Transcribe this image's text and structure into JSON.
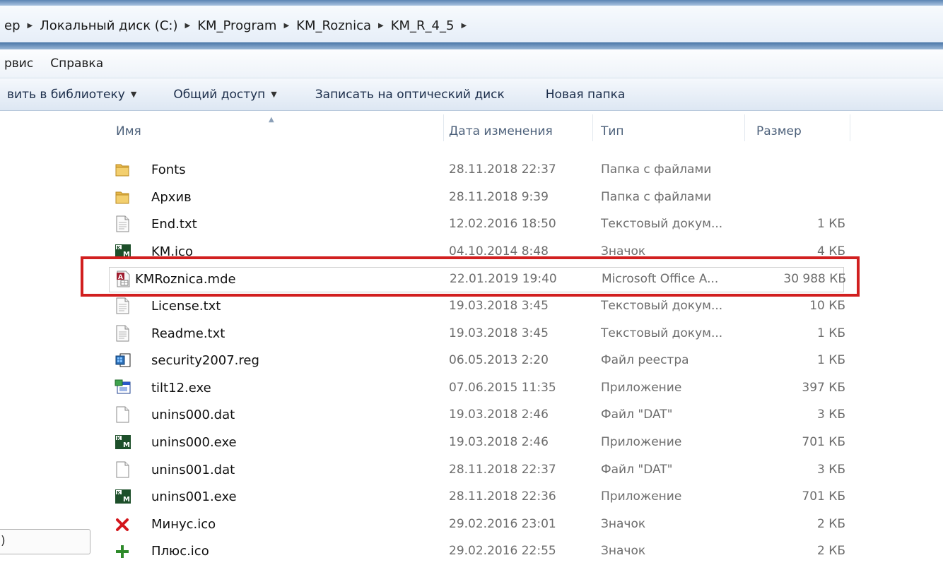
{
  "breadcrumb": {
    "items": [
      "ер",
      "Локальный диск (C:)",
      "KM_Program",
      "KM_Roznica",
      "KM_R_4_5"
    ]
  },
  "menu": {
    "items": [
      "рвис",
      "Справка"
    ]
  },
  "commands": {
    "add_to_library": "вить в библиотеку",
    "share": "Общий доступ",
    "burn": "Записать на оптический диск",
    "new_folder": "Новая папка"
  },
  "columns": {
    "name": "Имя",
    "date": "Дата изменения",
    "type": "Тип",
    "size": "Размер"
  },
  "nav": {
    "partial_label": ")"
  },
  "files": [
    {
      "name": "Fonts",
      "date": "28.11.2018 22:37",
      "type": "Папка с файлами",
      "size": "",
      "icon": "folder-icon"
    },
    {
      "name": "Архив",
      "date": "28.11.2018 9:39",
      "type": "Папка с файлами",
      "size": "",
      "icon": "folder-icon"
    },
    {
      "name": "End.txt",
      "date": "12.02.2016 18:50",
      "type": "Текстовый докум...",
      "size": "1 КБ",
      "icon": "text-file-icon"
    },
    {
      "name": "KM.ico",
      "date": "04.10.2014 8:48",
      "type": "Значок",
      "size": "4 КБ",
      "icon": "km-icon"
    },
    {
      "name": "KMRoznica.mde",
      "date": "22.01.2019 19:40",
      "type": "Microsoft Office A...",
      "size": "30 988 КБ",
      "icon": "access-file-icon"
    },
    {
      "name": "License.txt",
      "date": "19.03.2018 3:45",
      "type": "Текстовый докум...",
      "size": "10 КБ",
      "icon": "text-file-icon"
    },
    {
      "name": "Readme.txt",
      "date": "19.03.2018 3:45",
      "type": "Текстовый докум...",
      "size": "1 КБ",
      "icon": "text-file-icon"
    },
    {
      "name": "security2007.reg",
      "date": "06.05.2013 2:20",
      "type": "Файл реестра",
      "size": "1 КБ",
      "icon": "registry-icon"
    },
    {
      "name": "tilt12.exe",
      "date": "07.06.2015 11:35",
      "type": "Приложение",
      "size": "397 КБ",
      "icon": "exe-window-icon"
    },
    {
      "name": "unins000.dat",
      "date": "19.03.2018 2:46",
      "type": "Файл \"DAT\"",
      "size": "3 КБ",
      "icon": "blank-file-icon"
    },
    {
      "name": "unins000.exe",
      "date": "19.03.2018 2:46",
      "type": "Приложение",
      "size": "701 КБ",
      "icon": "km-icon"
    },
    {
      "name": "unins001.dat",
      "date": "28.11.2018 22:37",
      "type": "Файл \"DAT\"",
      "size": "3 КБ",
      "icon": "blank-file-icon"
    },
    {
      "name": "unins001.exe",
      "date": "28.11.2018 22:36",
      "type": "Приложение",
      "size": "701 КБ",
      "icon": "km-icon"
    },
    {
      "name": "Минус.ico",
      "date": "29.02.2016 23:01",
      "type": "Значок",
      "size": "2 КБ",
      "icon": "red-x-icon"
    },
    {
      "name": "Плюс.ico",
      "date": "29.02.2016 22:55",
      "type": "Значок",
      "size": "2 КБ",
      "icon": "green-plus-icon"
    }
  ],
  "colors": {
    "highlight": "#d11f1f",
    "folder": "#e8b84a",
    "km_icon_bg": "#1d4f2a"
  }
}
